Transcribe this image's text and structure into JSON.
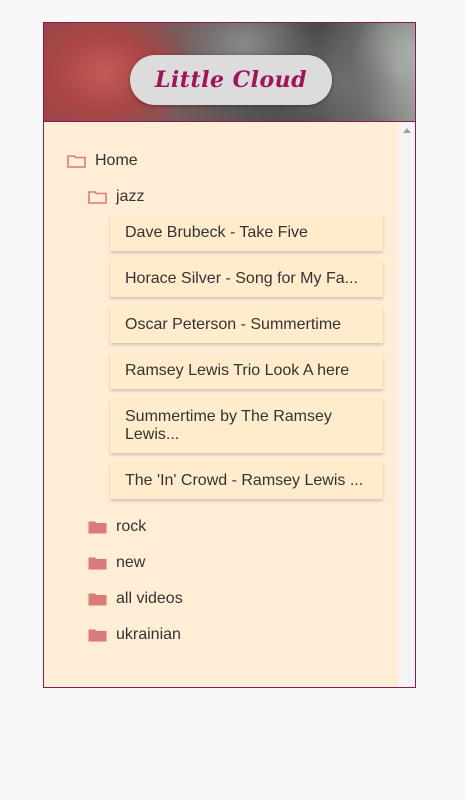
{
  "header": {
    "logo_text": "Little Cloud"
  },
  "tree": {
    "root": {
      "label": "Home",
      "icon": "folder-outline-icon"
    },
    "folders": [
      {
        "label": "jazz",
        "icon": "folder-outline-icon",
        "expanded": true
      },
      {
        "label": "rock",
        "icon": "folder-filled-icon"
      },
      {
        "label": "new",
        "icon": "folder-filled-icon"
      },
      {
        "label": "all videos",
        "icon": "folder-filled-icon"
      },
      {
        "label": "ukrainian",
        "icon": "folder-filled-icon"
      }
    ],
    "tracks": [
      "Dave Brubeck - Take Five",
      "Horace Silver - Song for My Fa...",
      "Oscar Peterson - Summertime",
      "Ramsey Lewis Trio Look A here",
      "Summertime by The Ramsey Lewis...",
      "The 'In' Crowd - Ramsey Lewis ..."
    ]
  },
  "colors": {
    "accent": "#8a1a55",
    "logo": "#a0145a",
    "panel": "#ffeed5",
    "folder": "#d97b7b"
  }
}
